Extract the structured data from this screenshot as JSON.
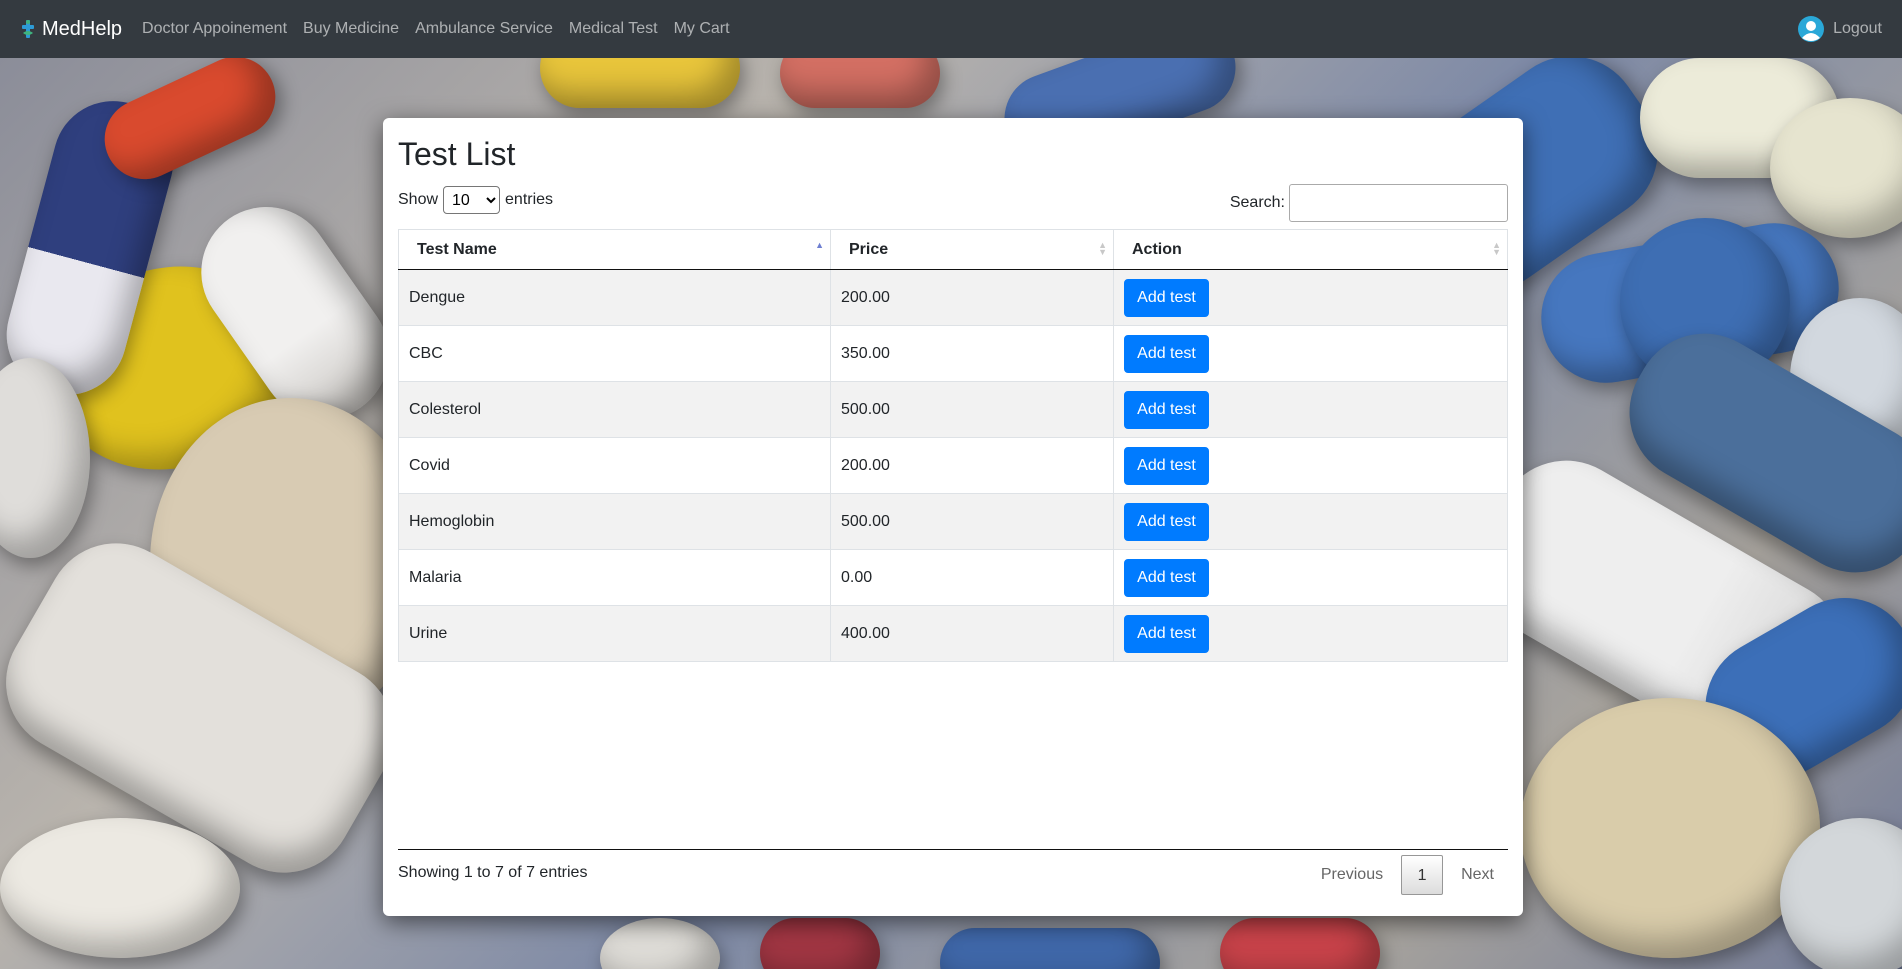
{
  "navbar": {
    "brand": "MedHelp",
    "links": [
      "Doctor Appoinement",
      "Buy Medicine",
      "Ambulance Service",
      "Medical Test",
      "My Cart"
    ],
    "logout": "Logout"
  },
  "page": {
    "title": "Test List",
    "show_label": "Show",
    "entries_label": "entries",
    "page_length": "10",
    "search_label": "Search:",
    "search_value": ""
  },
  "table": {
    "headers": [
      "Test Name",
      "Price",
      "Action"
    ],
    "rows": [
      {
        "name": "Dengue",
        "price": "200.00",
        "action": "Add test"
      },
      {
        "name": "CBC",
        "price": "350.00",
        "action": "Add test"
      },
      {
        "name": "Colesterol",
        "price": "500.00",
        "action": "Add test"
      },
      {
        "name": "Covid",
        "price": "200.00",
        "action": "Add test"
      },
      {
        "name": "Hemoglobin",
        "price": "500.00",
        "action": "Add test"
      },
      {
        "name": "Malaria",
        "price": "0.00",
        "action": "Add test"
      },
      {
        "name": "Urine",
        "price": "400.00",
        "action": "Add test"
      }
    ]
  },
  "footer": {
    "info": "Showing 1 to 7 of 7 entries",
    "previous": "Previous",
    "page": "1",
    "next": "Next"
  },
  "colors": {
    "navbar": "#343a40",
    "primary_button": "#007bff"
  }
}
